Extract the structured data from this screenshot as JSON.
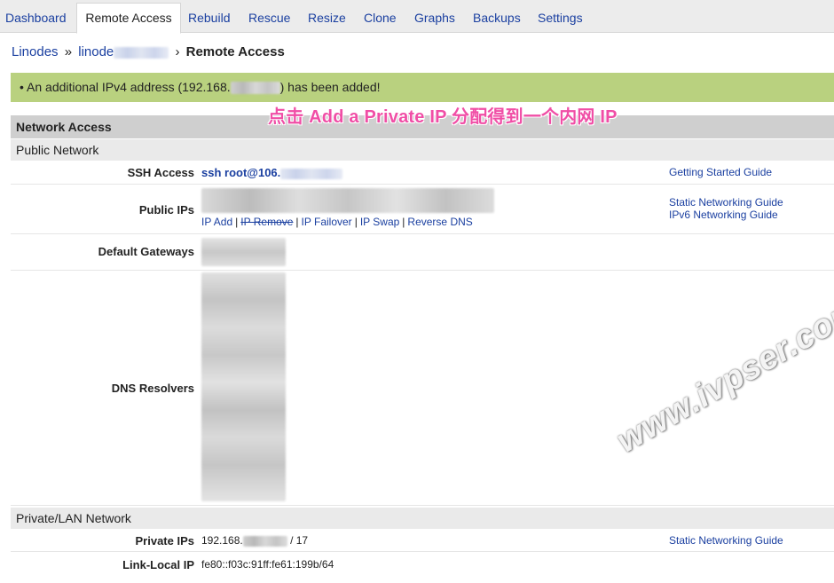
{
  "tabs": [
    {
      "label": "Dashboard"
    },
    {
      "label": "Remote Access"
    },
    {
      "label": "Rebuild"
    },
    {
      "label": "Rescue"
    },
    {
      "label": "Resize"
    },
    {
      "label": "Clone"
    },
    {
      "label": "Graphs"
    },
    {
      "label": "Backups"
    },
    {
      "label": "Settings"
    }
  ],
  "breadcrumb": {
    "root": "Linodes",
    "sep": "»",
    "node": "linode",
    "sep2": "›",
    "current": "Remote Access"
  },
  "notice": {
    "prefix": "• An additional IPv4 address (192.168.",
    "suffix": ") has been added!"
  },
  "annotation": "点击 Add a Private IP 分配得到一个内网 IP",
  "network_access": {
    "title": "Network Access",
    "public_network": "Public Network",
    "ssh": {
      "label": "SSH Access",
      "value": "ssh root@106.",
      "guide": "Getting Started Guide"
    },
    "public_ips": {
      "label": "Public IPs",
      "actions": {
        "ip_add": "IP Add",
        "ip_remove": "IP Remove",
        "ip_failover": "IP Failover",
        "ip_swap": "IP Swap",
        "reverse_dns": "Reverse DNS",
        "pipe": "|"
      },
      "guides": [
        "Static Networking Guide",
        "IPv6 Networking Guide"
      ]
    },
    "default_gateways": {
      "label": "Default Gateways"
    },
    "dns_resolvers": {
      "label": "DNS Resolvers"
    },
    "private_network": "Private/LAN Network",
    "private_ips": {
      "label": "Private IPs",
      "prefix": "192.168.",
      "suffix": "/ 17",
      "guide": "Static Networking Guide"
    },
    "link_local": {
      "label": "Link-Local IP",
      "value": "fe80::f03c:91ff:fe61:199b/64"
    }
  },
  "watermark": "www.ivpser.com"
}
